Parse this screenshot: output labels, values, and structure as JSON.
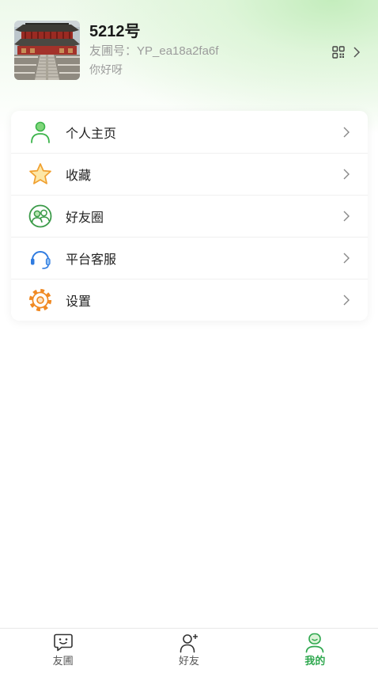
{
  "profile": {
    "name": "5212号",
    "id_text": "友圃号：YP_ea18a2fa6f",
    "bio": "你好呀"
  },
  "header_actions": {
    "qr_icon": "qr-code-icon",
    "chevron_icon": "chevron-right-icon"
  },
  "menu": [
    {
      "label": "个人主页",
      "icon": "person-icon",
      "icon_color": "#3cb44b"
    },
    {
      "label": "收藏",
      "icon": "star-icon",
      "icon_color": "#f0a030"
    },
    {
      "label": "好友圈",
      "icon": "friends-circle-icon",
      "icon_color": "#3a9a48"
    },
    {
      "label": "平台客服",
      "icon": "headset-icon",
      "icon_color": "#2f7be0"
    },
    {
      "label": "设置",
      "icon": "gear-icon",
      "icon_color": "#f08a24"
    }
  ],
  "tabbar": [
    {
      "label": "友圃",
      "icon": "chat-face-icon",
      "active": false
    },
    {
      "label": "好友",
      "icon": "person-add-icon",
      "active": false
    },
    {
      "label": "我的",
      "icon": "profile-icon",
      "active": true
    }
  ],
  "colors": {
    "accent": "#2fa84f",
    "header_tint": "#c4edbd",
    "text_primary": "#222222",
    "text_secondary": "#9c9c9c"
  }
}
